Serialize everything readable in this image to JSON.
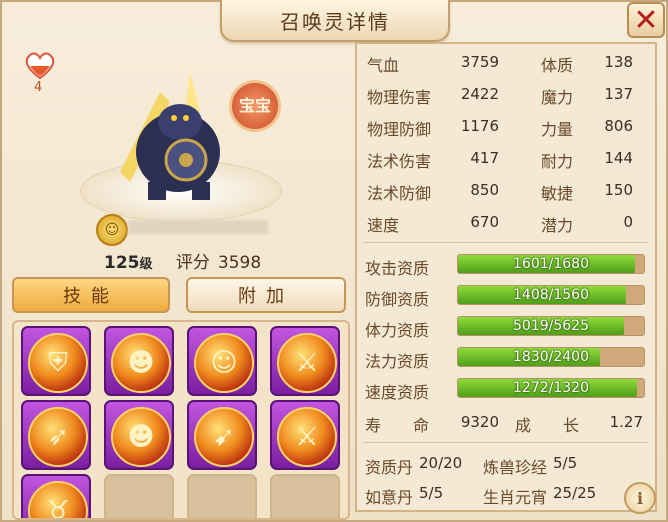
{
  "window": {
    "title": "召唤灵详情",
    "close_icon": "close-icon"
  },
  "summon": {
    "lifespan_heart": "4",
    "badge": "宝宝",
    "level_value": "125",
    "level_unit": "级",
    "score_label": "评分",
    "score_value": "3598"
  },
  "buttons": {
    "skills": "技能",
    "extra": "附加"
  },
  "skills": {
    "slots": [
      {
        "icon": "shield-skill-icon"
      },
      {
        "icon": "demon-skill-icon"
      },
      {
        "icon": "fire-face-skill-icon"
      },
      {
        "icon": "slash-skill-icon"
      },
      {
        "icon": "arrows-skill-icon"
      },
      {
        "icon": "flame-ghost-skill-icon"
      },
      {
        "icon": "spear-skill-icon"
      },
      {
        "icon": "blade-skill-icon"
      },
      {
        "icon": "horned-demon-skill-icon"
      }
    ],
    "empty_slots": 3
  },
  "stats": {
    "hp_label": "气血",
    "hp_value": "3759",
    "con_label": "体质",
    "con_value": "138",
    "patk_label": "物理伤害",
    "patk_value": "2422",
    "mag_label": "魔力",
    "mag_value": "137",
    "pdef_label": "物理防御",
    "pdef_value": "1176",
    "str_label": "力量",
    "str_value": "806",
    "matk_label": "法术伤害",
    "matk_value": "417",
    "end_label": "耐力",
    "end_value": "144",
    "mdef_label": "法术防御",
    "mdef_value": "850",
    "agi_label": "敏捷",
    "agi_value": "150",
    "spd_label": "速度",
    "spd_value": "670",
    "pot_label": "潜力",
    "pot_value": "0"
  },
  "aptitudes": [
    {
      "label": "攻击资质",
      "current": 1601,
      "max": 1680,
      "text": "1601/1680"
    },
    {
      "label": "防御资质",
      "current": 1408,
      "max": 1560,
      "text": "1408/1560"
    },
    {
      "label": "体力资质",
      "current": 5019,
      "max": 5625,
      "text": "5019/5625"
    },
    {
      "label": "法力资质",
      "current": 1830,
      "max": 2400,
      "text": "1830/2400"
    },
    {
      "label": "速度资质",
      "current": 1272,
      "max": 1320,
      "text": "1272/1320"
    }
  ],
  "life": {
    "life_label": "寿　　命",
    "life_value": "9320",
    "growth_label": "成　　长",
    "growth_value": "1.27"
  },
  "items": {
    "aptitude_pill_label": "资质丹",
    "aptitude_pill_value": "20/20",
    "beast_scroll_label": "炼兽珍经",
    "beast_scroll_value": "5/5",
    "ruyi_pill_label": "如意丹",
    "ruyi_pill_value": "5/5",
    "zodiac_label": "生肖元宵",
    "zodiac_value": "25/25"
  },
  "colors": {
    "bar_fill": "#6cc12a",
    "bar_track": "#cfa97a",
    "skill_frame": "#9b35c4",
    "accent": "#f0aa3e"
  }
}
